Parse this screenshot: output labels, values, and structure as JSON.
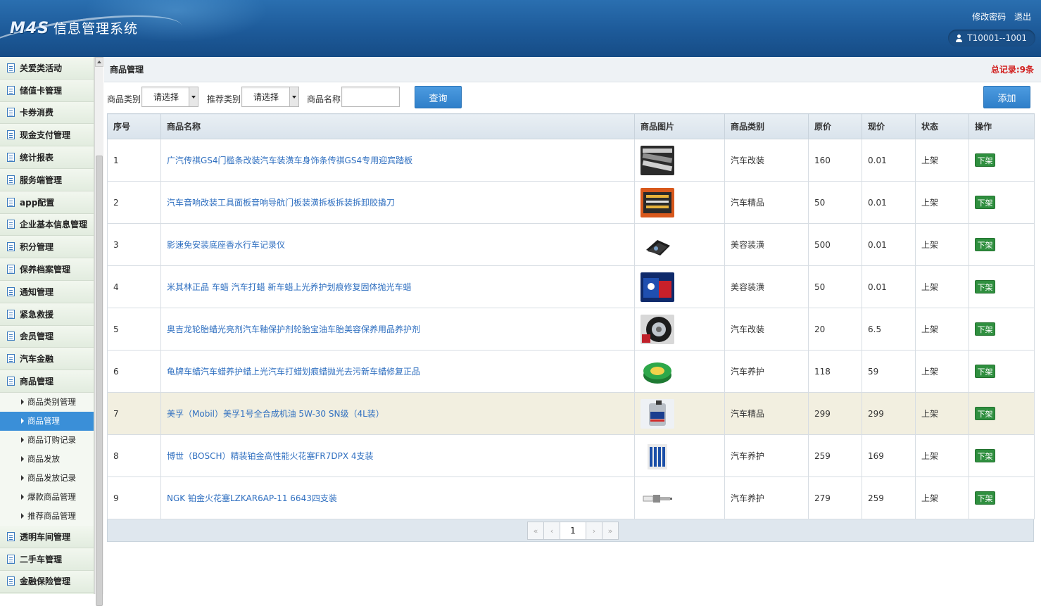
{
  "app": {
    "logo_mark": "M4S",
    "title": "信息管理系统"
  },
  "header": {
    "change_password": "修改密码",
    "logout": "退出",
    "user": "T10001--1001"
  },
  "sidebar": {
    "menu_top": [
      "关爱类活动",
      "储值卡管理",
      "卡券消费",
      "现金支付管理",
      "统计报表",
      "服务端管理",
      "app配置",
      "企业基本信息管理",
      "积分管理",
      "保养档案管理",
      "通知管理",
      "紧急救援",
      "会员管理",
      "汽车金融",
      "商品管理"
    ],
    "submenu": [
      "商品类别管理",
      "商品管理",
      "商品订购记录",
      "商品发放",
      "商品发放记录",
      "爆款商品管理",
      "推荐商品管理"
    ],
    "submenu_active_index": 1,
    "menu_bottom": [
      "透明车间管理",
      "二手车管理",
      "金融保险管理"
    ]
  },
  "page": {
    "title": "商品管理",
    "total": "总记录:9条"
  },
  "search": {
    "category_label": "商品类别",
    "category_value": "请选择",
    "recommend_label": "推荐类别",
    "recommend_value": "请选择",
    "name_label": "商品名称",
    "name_value": "",
    "query_button": "查询",
    "add_button": "添加"
  },
  "table": {
    "columns": [
      "序号",
      "商品名称",
      "商品图片",
      "商品类别",
      "原价",
      "现价",
      "状态",
      "操作"
    ],
    "rows": [
      {
        "no": "1",
        "name": "广汽传祺GS4门槛条改装汽车装潢车身饰条传祺GS4专用迎宾踏板",
        "category": "汽车改装",
        "orig": "160",
        "price": "0.01",
        "status": "上架",
        "action": "下架",
        "thumb": "sill-plate"
      },
      {
        "no": "2",
        "name": "汽车音响改装工具面板音响导航门板装潢拆板拆装拆卸胶撬刀",
        "category": "汽车精品",
        "orig": "50",
        "price": "0.01",
        "status": "上架",
        "action": "下架",
        "thumb": "tool-kit"
      },
      {
        "no": "3",
        "name": "影速免安装底座香水行车记录仪",
        "category": "美容装潢",
        "orig": "500",
        "price": "0.01",
        "status": "上架",
        "action": "下架",
        "thumb": "dash-camera"
      },
      {
        "no": "4",
        "name": "米其林正品 车蜡 汽车打蜡 新车蜡上光养护划痕修复固体抛光车蜡",
        "category": "美容装潢",
        "orig": "50",
        "price": "0.01",
        "status": "上架",
        "action": "下架",
        "thumb": "wax-box"
      },
      {
        "no": "5",
        "name": "奥吉龙轮胎蜡光亮剂汽车釉保护剂轮胎宝油车胎美容保养用品养护剂",
        "category": "汽车改装",
        "orig": "20",
        "price": "6.5",
        "status": "上架",
        "action": "下架",
        "thumb": "tire"
      },
      {
        "no": "6",
        "name": "龟牌车蜡汽车蜡养护蜡上光汽车打蜡划痕蜡抛光去污新车蜡修复正品",
        "category": "汽车养护",
        "orig": "118",
        "price": "59",
        "status": "上架",
        "action": "下架",
        "thumb": "wax-tin"
      },
      {
        "no": "7",
        "name": "美孚（Mobil）美孚1号全合成机油 5W-30 SN级（4L装）",
        "category": "汽车精品",
        "orig": "299",
        "price": "299",
        "status": "上架",
        "action": "下架",
        "thumb": "oil-bottle"
      },
      {
        "no": "8",
        "name": "博世（BOSCH）精装铂金高性能火花塞FR7DPX 4支装",
        "category": "汽车养护",
        "orig": "259",
        "price": "169",
        "status": "上架",
        "action": "下架",
        "thumb": "spark-plugs"
      },
      {
        "no": "9",
        "name": "NGK 铂金火花塞LZKAR6AP-11 6643四支装",
        "category": "汽车养护",
        "orig": "279",
        "price": "259",
        "status": "上架",
        "action": "下架",
        "thumb": "spark-plug"
      }
    ],
    "highlight_row_index": 6
  },
  "pager": {
    "first": "«",
    "prev": "‹",
    "current": "1",
    "next": "›",
    "last": "»"
  }
}
